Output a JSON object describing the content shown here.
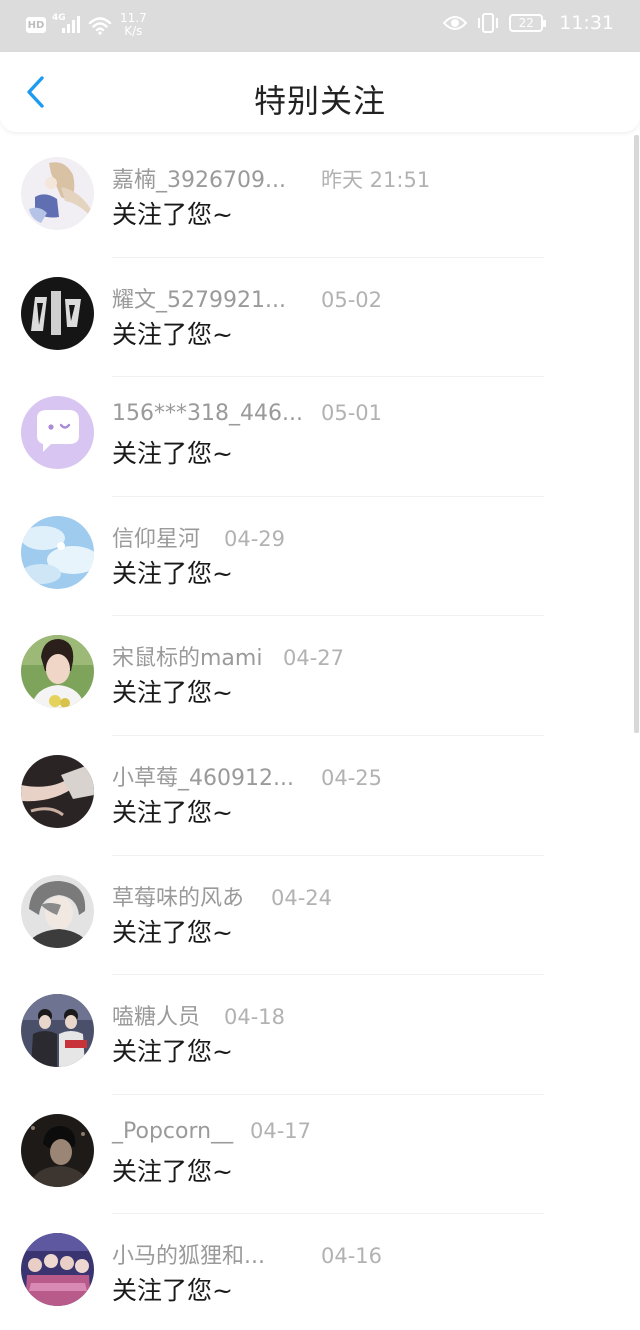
{
  "status_bar": {
    "hd": "HD",
    "network": "4G",
    "speed_value": "11.7",
    "speed_unit": "K/s",
    "battery": "22",
    "time": "11:31"
  },
  "header": {
    "title": "特别关注"
  },
  "notifications": [
    {
      "name": "嘉楠_3926709...",
      "time": "昨天 21:51",
      "message": "关注了您~"
    },
    {
      "name": "耀文_5279921...",
      "time": "05-02",
      "message": "关注了您~"
    },
    {
      "name": "156***318_446...",
      "time": "05-01",
      "message": "关注了您~"
    },
    {
      "name": "信仰星河",
      "time": "04-29",
      "message": "关注了您~"
    },
    {
      "name": "宋鼠标的mami",
      "time": "04-27",
      "message": "关注了您~"
    },
    {
      "name": "小草莓_460912...",
      "time": "04-25",
      "message": "关注了您~"
    },
    {
      "name": "草莓味的风あ",
      "time": "04-24",
      "message": "关注了您~"
    },
    {
      "name": "嗑糖人员",
      "time": "04-18",
      "message": "关注了您~"
    },
    {
      "name": "_Popcorn__",
      "time": "04-17",
      "message": "关注了您~"
    },
    {
      "name": "小马的狐狸和...",
      "time": "04-16",
      "message": "关注了您~"
    }
  ],
  "colors": {
    "accent": "#1e9bf0",
    "status_bar_bg": "#dcdcdc",
    "name_text": "#9a9a9a",
    "time_text": "#b2b2b2"
  }
}
